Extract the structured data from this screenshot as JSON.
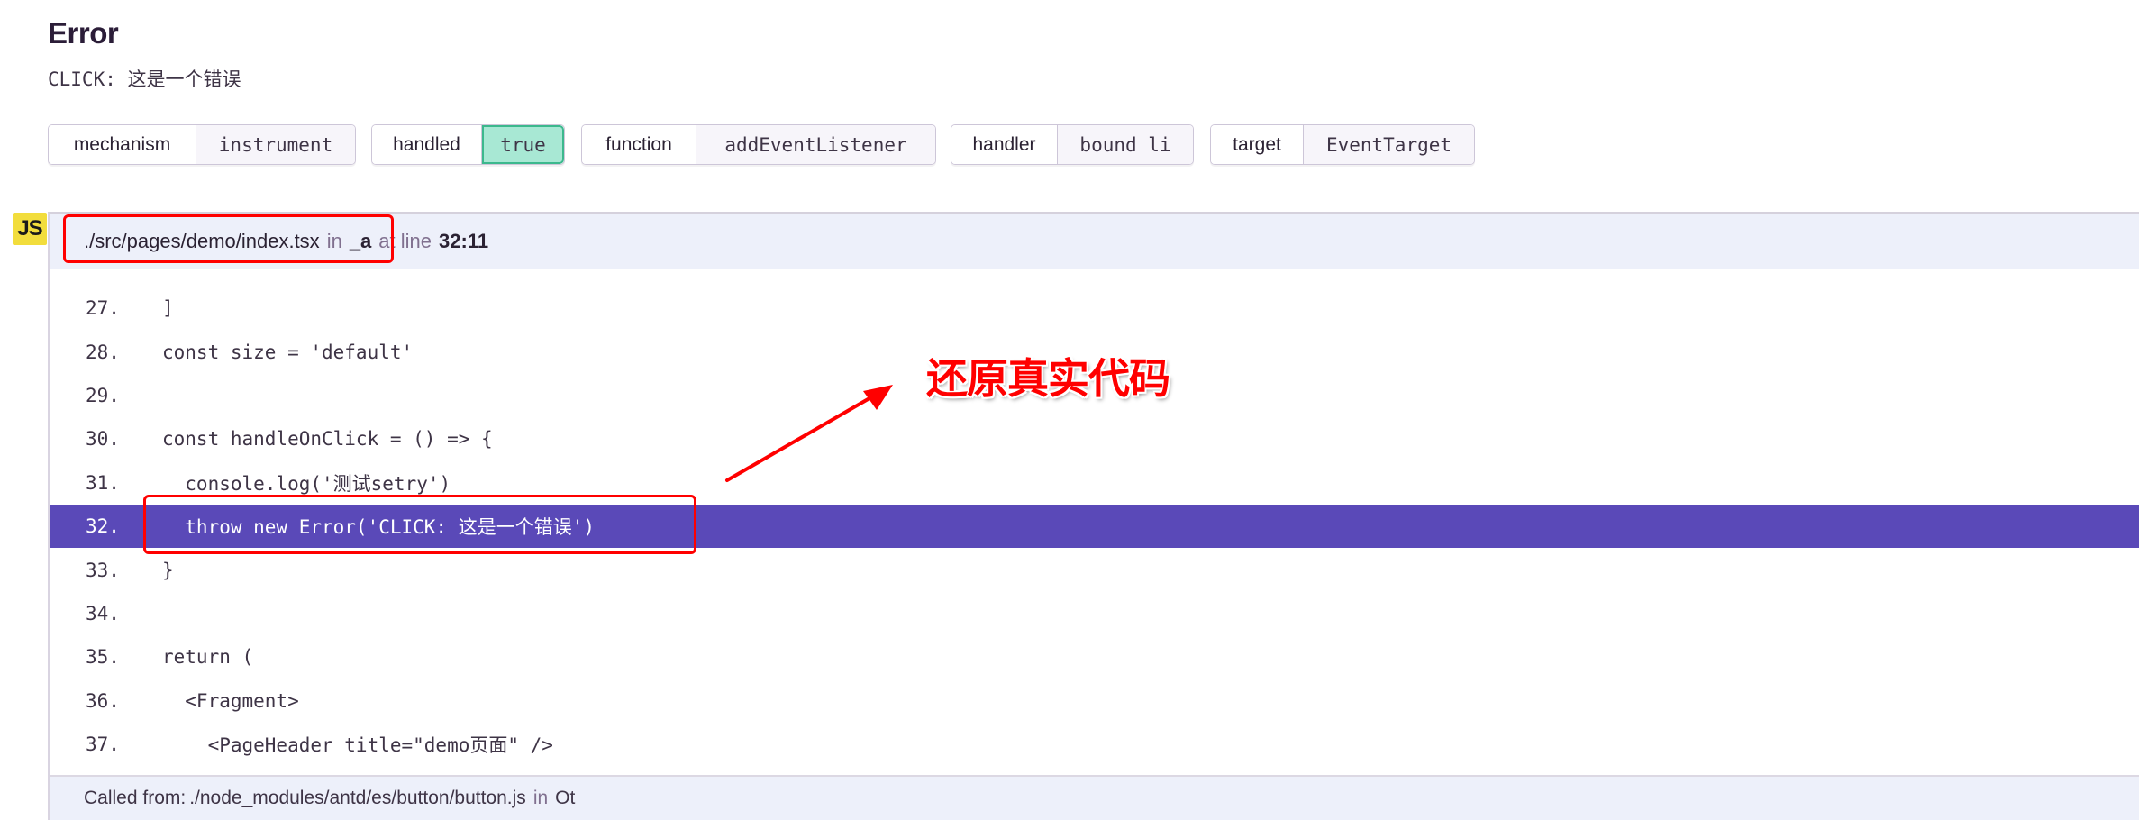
{
  "error": {
    "title": "Error",
    "message": "CLICK: 这是一个错误"
  },
  "tags": [
    {
      "key": "mechanism",
      "value": "instrument"
    },
    {
      "key": "handled",
      "value": "true",
      "highlight_color": "#a8e8d4"
    },
    {
      "key": "function",
      "value": "addEventListener"
    },
    {
      "key": "handler",
      "value": "bound li"
    },
    {
      "key": "target",
      "value": "EventTarget"
    }
  ],
  "frame": {
    "platform_icon": "js-icon",
    "platform_label": "JS",
    "filename": "./src/pages/demo/index.tsx",
    "in_label": "in",
    "function": "_a",
    "at_line_label": "at line",
    "location": "32:11",
    "active_line": 32,
    "active_color": "#5a49b8",
    "lines": [
      {
        "num": "27.",
        "code": "]"
      },
      {
        "num": "28.",
        "code": "const size = 'default'"
      },
      {
        "num": "29.",
        "code": ""
      },
      {
        "num": "30.",
        "code": "const handleOnClick = () => {"
      },
      {
        "num": "31.",
        "code": "  console.log('测试setry')"
      },
      {
        "num": "32.",
        "code": "  throw new Error('CLICK: 这是一个错误')"
      },
      {
        "num": "33.",
        "code": "}"
      },
      {
        "num": "34.",
        "code": ""
      },
      {
        "num": "35.",
        "code": "return ("
      },
      {
        "num": "36.",
        "code": "  <Fragment>"
      },
      {
        "num": "37.",
        "code": "    <PageHeader title=\"demo页面\" />"
      }
    ],
    "called_from_label": "Called from:",
    "called_from_file": "./node_modules/antd/es/button/button.js",
    "called_from_in": "in",
    "called_from_function": "Ot"
  },
  "annotation": {
    "text": "还原真实代码",
    "color": "#ff0000"
  }
}
